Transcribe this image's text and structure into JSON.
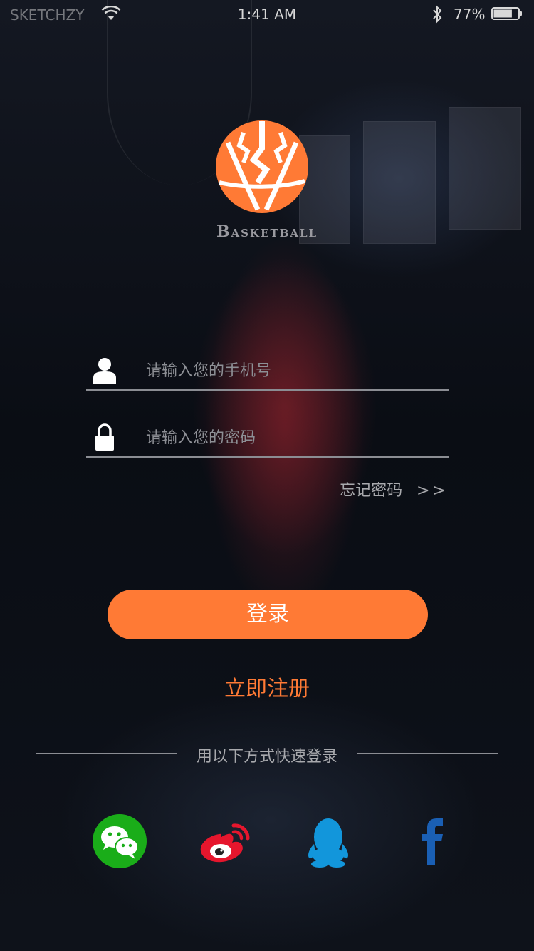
{
  "status_bar": {
    "carrier": "SKETCHZY",
    "time": "1:41 AM",
    "battery_percent": "77%",
    "battery_level": 0.77
  },
  "logo": {
    "text": "Basketball",
    "color": "#ff7a35"
  },
  "phone_field": {
    "placeholder": "请输入您的手机号",
    "value": ""
  },
  "password_field": {
    "placeholder": "请输入您的密码",
    "value": ""
  },
  "forgot": {
    "label": "忘记密码",
    "arrows": ">>"
  },
  "login_button": {
    "label": "登录"
  },
  "register_link": {
    "label": "立即注册"
  },
  "quick_login": {
    "label": "用以下方式快速登录",
    "providers": [
      {
        "name": "wechat",
        "icon": "wechat-icon",
        "color": "#1aad19"
      },
      {
        "name": "weibo",
        "icon": "weibo-icon",
        "color": "#e6162d"
      },
      {
        "name": "qq",
        "icon": "qq-icon",
        "color": "#1296db"
      },
      {
        "name": "facebook",
        "icon": "facebook-icon",
        "color": "#1a5fb4"
      }
    ]
  },
  "colors": {
    "accent": "#ff7a35",
    "line": "#8b8d93"
  }
}
